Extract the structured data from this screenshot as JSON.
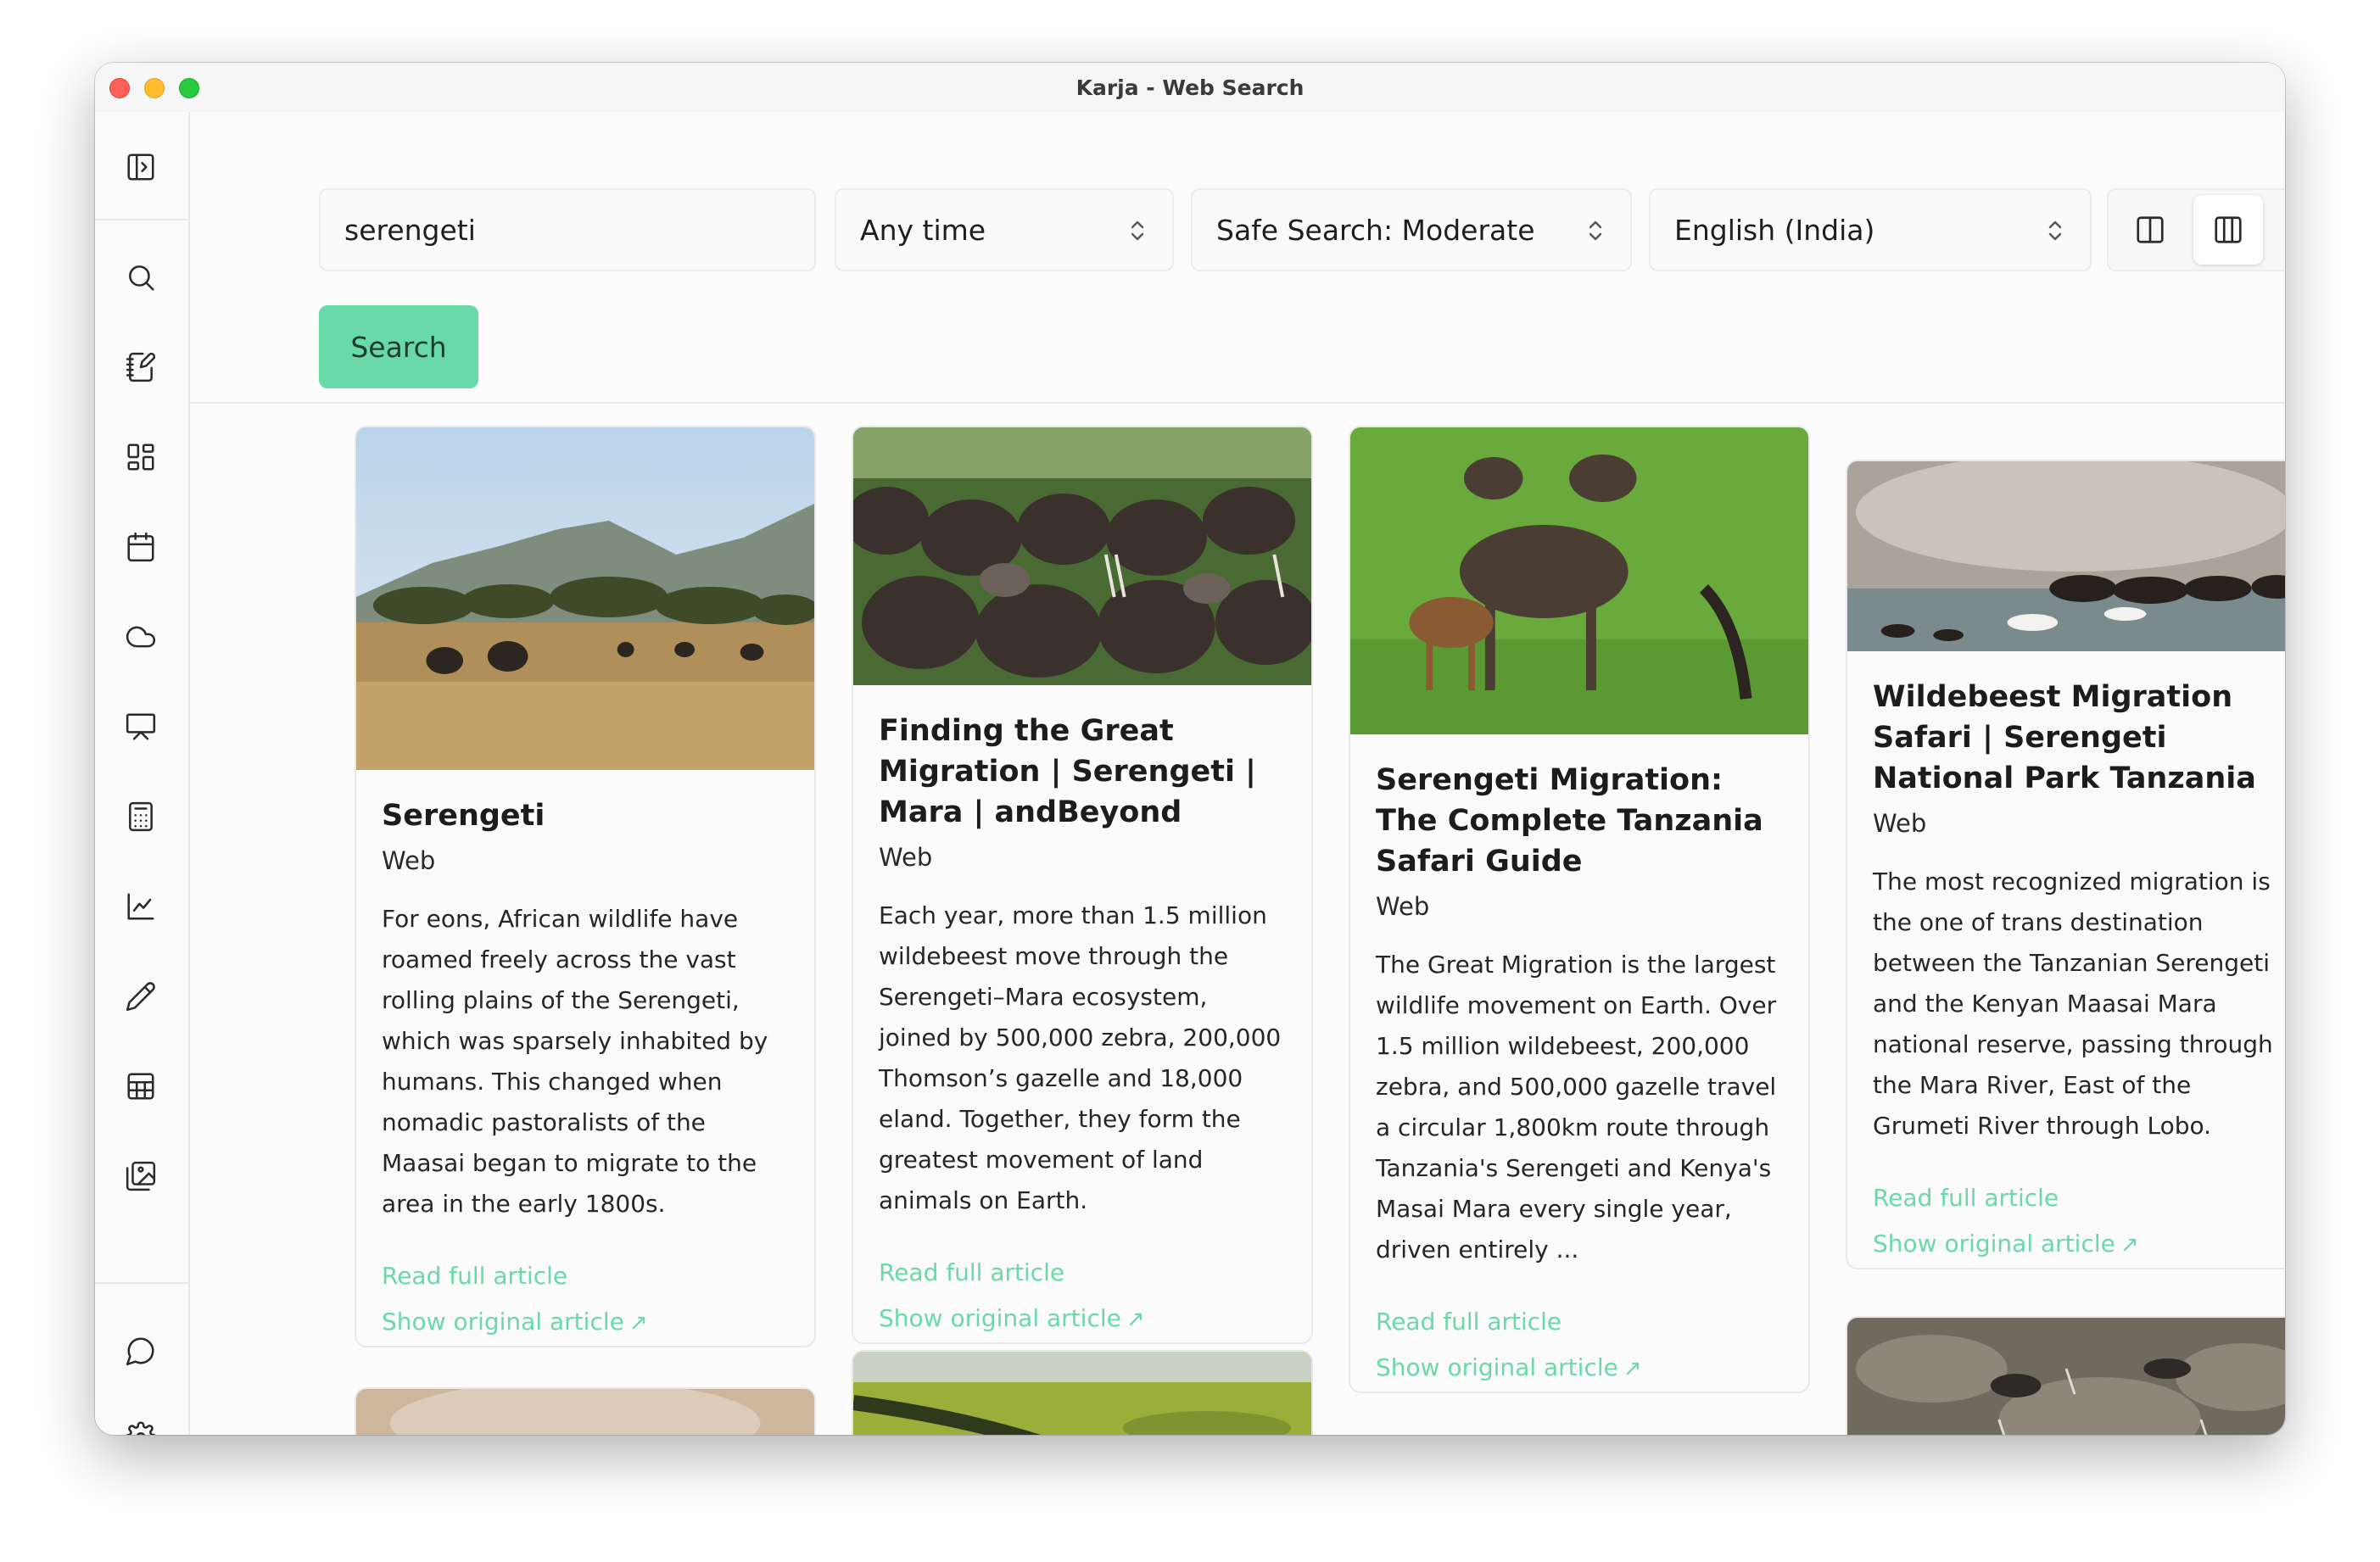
{
  "window": {
    "title": "Karja - Web Search"
  },
  "search": {
    "query": "serengeti",
    "time_filter": "Any time",
    "safe_search": "Safe Search: Moderate",
    "language": "English (India)",
    "button_label": "Search"
  },
  "sidebar": {
    "items": [
      "toggle-sidebar",
      "search",
      "notes",
      "dashboard",
      "calendar",
      "cloud",
      "presentation",
      "calculator",
      "chart",
      "pencil",
      "table",
      "gallery",
      "chat",
      "settings"
    ]
  },
  "view_modes": {
    "selected": 2
  },
  "results": [
    {
      "title": "Serengeti",
      "source": "Web",
      "snippet": "For eons, African wildlife have roamed freely across the vast rolling plains of the Serengeti, which was sparsely inhabited by humans. This changed when nomadic pastoralists of the Maasai began to migrate to the area in the early 1800s.",
      "read_label": "Read full article",
      "original_label": "Show original article"
    },
    {
      "title": "Finding the Great Migration | Serengeti | Mara | andBeyond",
      "source": "Web",
      "snippet": "Each year, more than 1.5 million wildebeest move through the Serengeti–Mara ecosystem, joined by 500,000 zebra, 200,000 Thomson’s gazelle and 18,000 eland. Together, they form the greatest movement of land animals on Earth.",
      "read_label": "Read full article",
      "original_label": "Show original article"
    },
    {
      "title": "Serengeti Migration: The Complete Tanzania Safari Guide",
      "source": "Web",
      "snippet": "The Great Migration is the largest wildlife movement on Earth. Over 1.5 million wildebeest, 200,000 zebra, and 500,000 gazelle travel a circular 1,800km route through Tanzania's Serengeti and Kenya's Masai Mara every single year, driven entirely ...",
      "read_label": "Read full article",
      "original_label": "Show original article"
    },
    {
      "title": "Wildebeest Migration Safari | Serengeti National Park Tanzania",
      "source": "Web",
      "snippet": "The most recognized migration is the one of trans destination between the Tanzanian Serengeti and the Kenyan Maasai Mara national reserve, passing through the Mara River, East of the Grumeti River through Lobo.",
      "read_label": "Read full article",
      "original_label": "Show original article"
    }
  ],
  "icons": {
    "link_arrow": "↗"
  },
  "colors": {
    "accent": "#6ad9a8",
    "search_button_text": "#1e3d30"
  }
}
